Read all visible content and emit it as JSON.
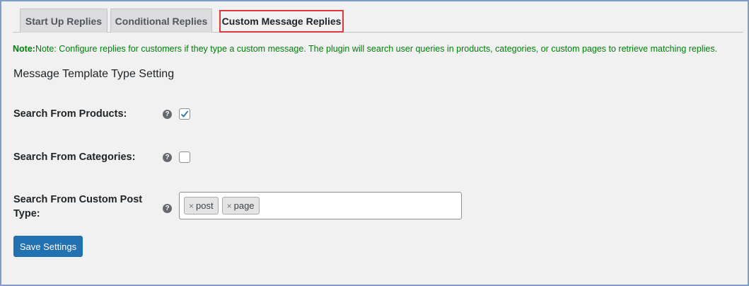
{
  "tabs": [
    {
      "label": "Start Up Replies"
    },
    {
      "label": "Conditional Replies"
    },
    {
      "label": "Custom Message Replies"
    }
  ],
  "note": {
    "prefix": "Note:",
    "text": "Note: Configure replies for customers if they type a custom message. The plugin will search user queries in products, categories, or custom pages to retrieve matching replies."
  },
  "section_title": "Message Template Type Setting",
  "fields": {
    "products": {
      "label": "Search From Products:",
      "checked": true
    },
    "categories": {
      "label": "Search From Categories:",
      "checked": false
    },
    "custom_post": {
      "label_line1": "Search From Custom Post",
      "label_line2": "Type:"
    }
  },
  "tags": [
    {
      "remove": "×",
      "label": "post"
    },
    {
      "remove": "×",
      "label": "page"
    }
  ],
  "help_glyph": "?",
  "save_label": "Save Settings",
  "colors": {
    "accent": "#2271b1",
    "note": "#00800a",
    "active_tab_border": "#e0393b"
  }
}
